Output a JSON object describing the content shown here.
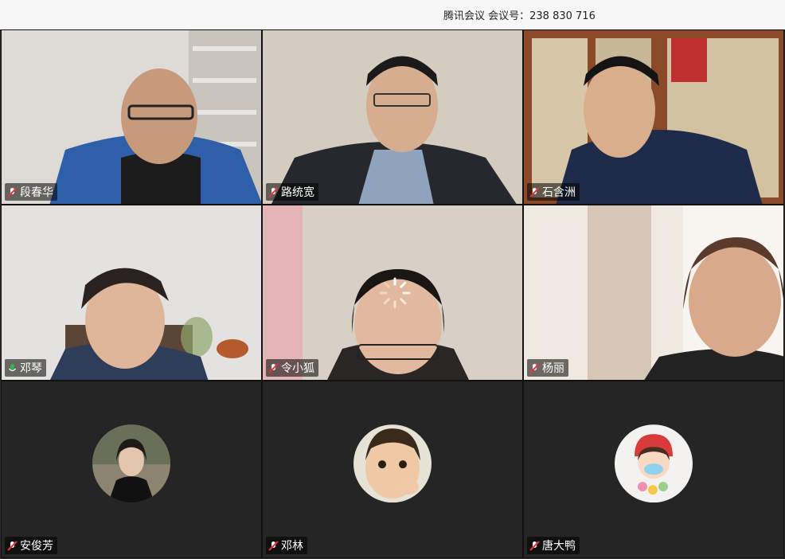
{
  "window": {
    "title": "腾讯会议 会议号：238 830 716"
  },
  "participants": [
    {
      "name": "段春华",
      "mic": "muted"
    },
    {
      "name": "路统宽",
      "mic": "muted"
    },
    {
      "name": "石含洲",
      "mic": "muted"
    },
    {
      "name": "邓琴",
      "mic": "active"
    },
    {
      "name": "令小狐",
      "mic": "muted"
    },
    {
      "name": "杨丽",
      "mic": "muted"
    },
    {
      "name": "安俊芳",
      "mic": "muted"
    },
    {
      "name": "邓林",
      "mic": "muted"
    },
    {
      "name": "唐大鸭",
      "mic": "muted"
    }
  ],
  "colors": {
    "mic_muted": "#e0353b",
    "mic_active": "#2fb34a",
    "tile_bg_off": "#252525"
  }
}
